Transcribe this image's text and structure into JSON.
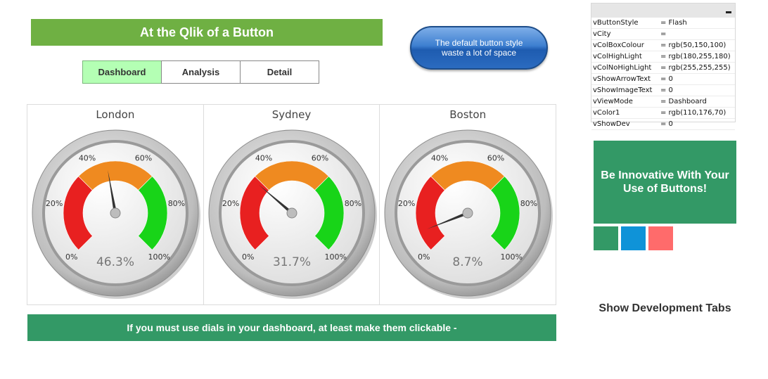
{
  "header": {
    "title": "At the Qlik of a Button"
  },
  "tabs": [
    {
      "label": "Dashboard",
      "active": true
    },
    {
      "label": "Analysis",
      "active": false
    },
    {
      "label": "Detail",
      "active": false
    }
  ],
  "default_button": {
    "label": "The default button style waste a lot of space"
  },
  "gauges": [
    {
      "city": "London",
      "value": 46.3,
      "display": "46.3%"
    },
    {
      "city": "Sydney",
      "value": 31.7,
      "display": "31.7%"
    },
    {
      "city": "Boston",
      "value": 8.7,
      "display": "8.7%"
    }
  ],
  "gauge_ticks": [
    "0%",
    "20%",
    "40%",
    "60%",
    "80%",
    "100%"
  ],
  "gauge_bands": [
    {
      "from": 0,
      "to": 33.3,
      "color": "#e82020"
    },
    {
      "from": 33.3,
      "to": 66.7,
      "color": "#ef8a20"
    },
    {
      "from": 66.7,
      "to": 100,
      "color": "#18d418"
    }
  ],
  "footer_banner": {
    "text": "If you must use dials in your dashboard, at least make them clickable -"
  },
  "variables": [
    {
      "name": "vButtonStyle",
      "value": "= Flash"
    },
    {
      "name": "vCity",
      "value": "="
    },
    {
      "name": "vColBoxColour",
      "value": "= rgb(50,150,100)"
    },
    {
      "name": "vColHighLight",
      "value": "= rgb(180,255,180)"
    },
    {
      "name": "vColNoHighLight",
      "value": "= rgb(255,255,255)"
    },
    {
      "name": "vShowArrowText",
      "value": "= 0"
    },
    {
      "name": "vShowImageText",
      "value": "= 0"
    },
    {
      "name": "vViewMode",
      "value": "= Dashboard"
    },
    {
      "name": "vColor1",
      "value": "= rgb(110,176,70)"
    },
    {
      "name": "vShowDev",
      "value": "= 0"
    }
  ],
  "promo_box": {
    "text": "Be Innovative With Your Use of Buttons!"
  },
  "swatches": [
    {
      "name": "green",
      "color": "#339966"
    },
    {
      "name": "blue",
      "color": "#0f93d8"
    },
    {
      "name": "red",
      "color": "#ff6b6b"
    }
  ],
  "dev_tabs_link": {
    "label": "Show Development Tabs"
  },
  "colors": {
    "title_bar": "#6fb043",
    "box_green": "#339966",
    "highlight": "#b4ffb4"
  }
}
